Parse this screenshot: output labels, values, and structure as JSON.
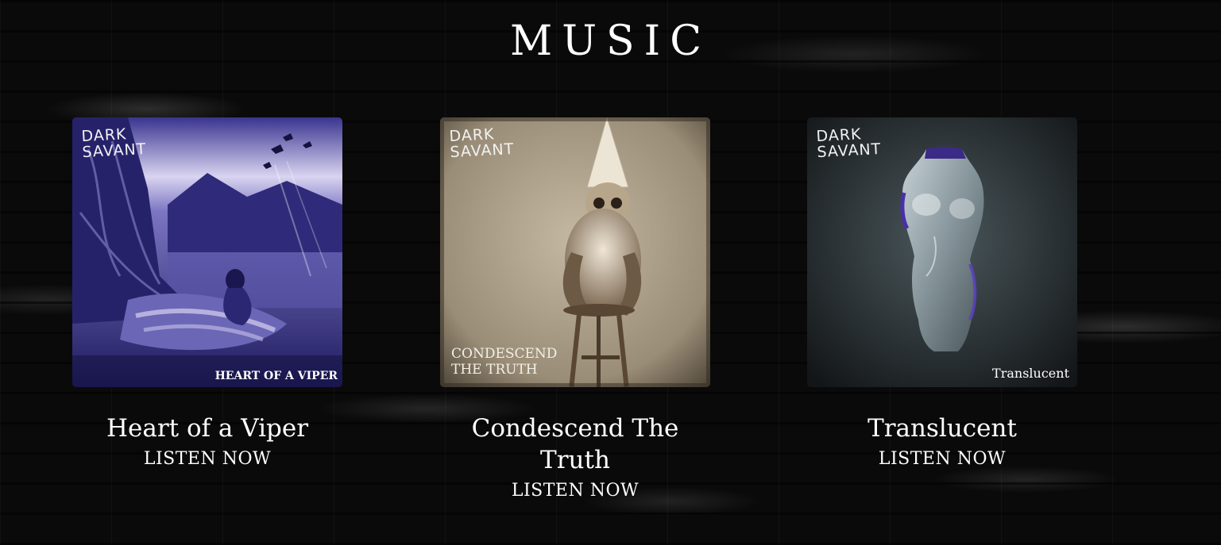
{
  "page": {
    "title": "MUSIC"
  },
  "albums": [
    {
      "title": "Heart of a Viper",
      "cover_band_line1": "DARK",
      "cover_band_line2": "SAVANT",
      "cover_caption": "HEART OF A VIPER",
      "link_label": "LISTEN NOW",
      "cover_colors": {
        "base": "#2a2672",
        "accent": "#c9c3e8"
      }
    },
    {
      "title": "Condescend The Truth",
      "cover_band_line1": "DARK",
      "cover_band_line2": "SAVANT",
      "cover_caption_line1": "CONDESCEND",
      "cover_caption_line2": "THE TRUTH",
      "link_label": "LISTEN NOW",
      "cover_colors": {
        "base": "#8c7f6c",
        "accent": "#d9ceb9"
      }
    },
    {
      "title": "Translucent",
      "cover_band_line1": "DARK",
      "cover_band_line2": "SAVANT",
      "cover_caption": "Translucent",
      "link_label": "LISTEN NOW",
      "cover_colors": {
        "base": "#1d2224",
        "accent": "#8fa0a6"
      }
    }
  ]
}
